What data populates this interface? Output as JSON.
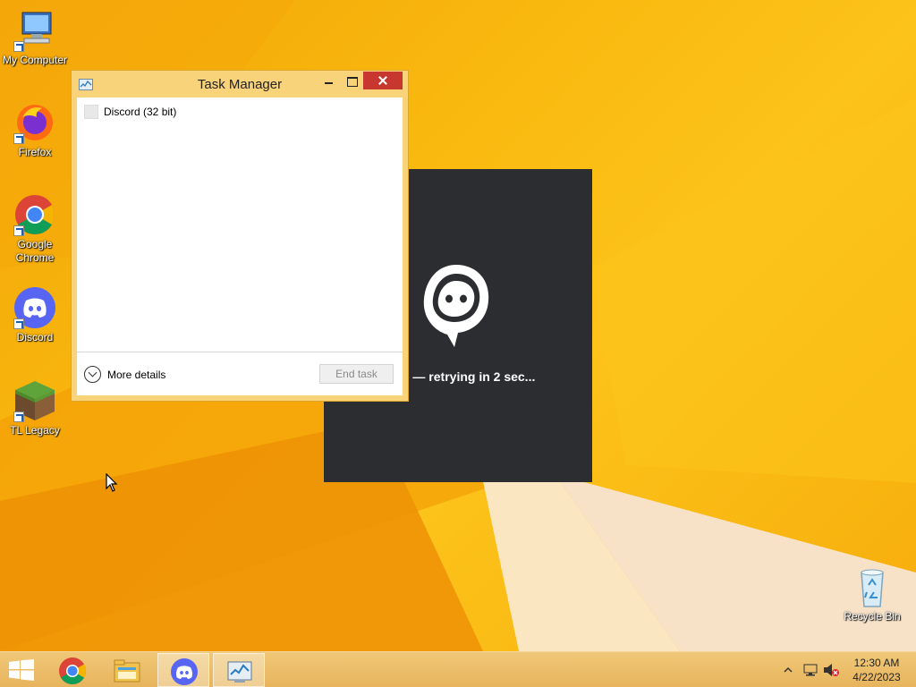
{
  "desktop": {
    "icons": [
      {
        "label": "My Computer",
        "icon": "computer-icon"
      },
      {
        "label": "Firefox",
        "icon": "firefox-icon"
      },
      {
        "label": "Google Chrome",
        "icon": "chrome-icon"
      },
      {
        "label": "Discord",
        "icon": "discord-icon"
      },
      {
        "label": "TL Legacy",
        "icon": "minecraft-grass-block-icon"
      },
      {
        "label": "Recycle Bin",
        "icon": "recycle-bin-icon"
      }
    ]
  },
  "discord_splash": {
    "status_text": "ailed — retrying in 2 sec..."
  },
  "task_manager": {
    "title": "Task Manager",
    "processes": [
      {
        "name": "Discord (32 bit)"
      }
    ],
    "more_details_label": "More details",
    "end_task_label": "End task"
  },
  "taskbar": {
    "items": [
      {
        "name": "start",
        "icon": "windows-logo-icon"
      },
      {
        "name": "chrome",
        "icon": "chrome-icon"
      },
      {
        "name": "file-explorer",
        "icon": "folder-icon"
      },
      {
        "name": "discord",
        "icon": "discord-icon"
      },
      {
        "name": "task-manager",
        "icon": "task-manager-icon"
      }
    ],
    "tray_icons": [
      "chevron-up-icon",
      "network-icon",
      "volume-muted-icon"
    ],
    "clock": {
      "time": "12:30 AM",
      "date": "4/22/2023"
    }
  },
  "colors": {
    "wallpaper": "#f6b10c",
    "discord_blurple": "#5865f2",
    "splash_bg": "#2b2d31",
    "close_button": "#c7372f"
  }
}
